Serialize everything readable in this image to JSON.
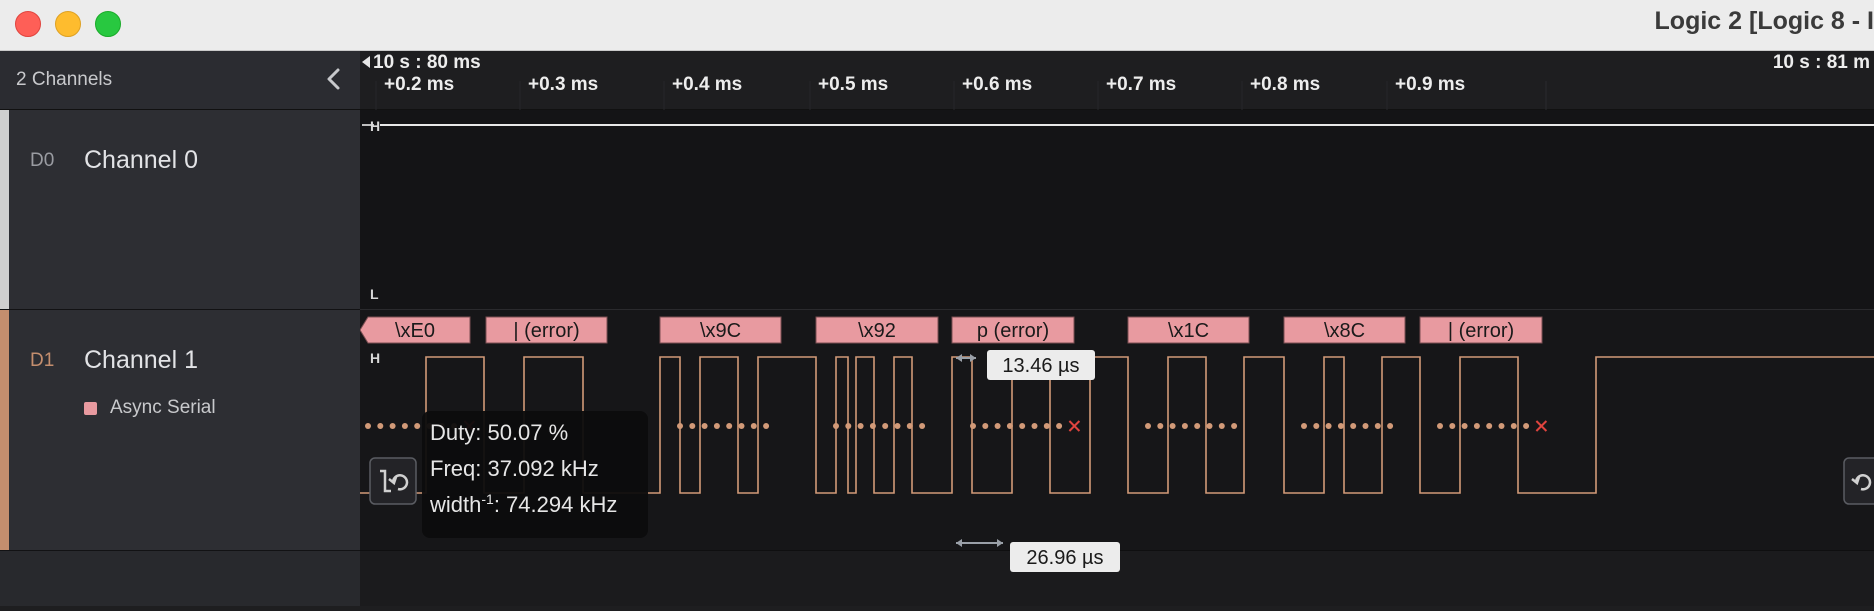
{
  "window": {
    "title": "Logic 2 [Logic 8 - I"
  },
  "sidebar": {
    "header_label": "2 Channels",
    "channels": [
      {
        "id": "D0",
        "name": "Channel 0",
        "color": "#d4d4d4"
      },
      {
        "id": "D1",
        "name": "Channel 1",
        "color": "#d29a78",
        "analyzer": {
          "name": "Async Serial",
          "color": "#e89aa0"
        }
      }
    ]
  },
  "timeline": {
    "start_label": "10 s : 80 ms",
    "end_label": "10 s : 81 m",
    "ticks": [
      "+0.2 ms",
      "+0.3 ms",
      "+0.4 ms",
      "+0.5 ms",
      "+0.6 ms",
      "+0.7 ms",
      "+0.8 ms",
      "+0.9 ms"
    ]
  },
  "rail_labels": {
    "high": "H",
    "low": "L"
  },
  "decoded_frames": [
    "\\xE0",
    "| (error)",
    "\\x9C",
    "\\x92",
    "p (error)",
    "\\x1C",
    "\\x8C",
    "| (error)"
  ],
  "measurements": {
    "pulse_width": "13.46 µs",
    "period": "26.96 µs",
    "tooltip": {
      "duty": "Duty: 50.07 %",
      "freq": "Freq: 37.092 kHz",
      "width_prefix": "width",
      "width_sup": "-1",
      "width_value": ": 74.294 kHz"
    }
  },
  "colors": {
    "accent_frame": "#e89aa0",
    "signal_d1": "#d29a78",
    "signal_d0": "#d4d4d4",
    "error_mark": "#e0443e",
    "bit_dot": "#d29a78"
  },
  "icons": {
    "collapse": "chevron-left-icon",
    "measure": "measure-edge-icon",
    "error": "x-mark-icon"
  }
}
